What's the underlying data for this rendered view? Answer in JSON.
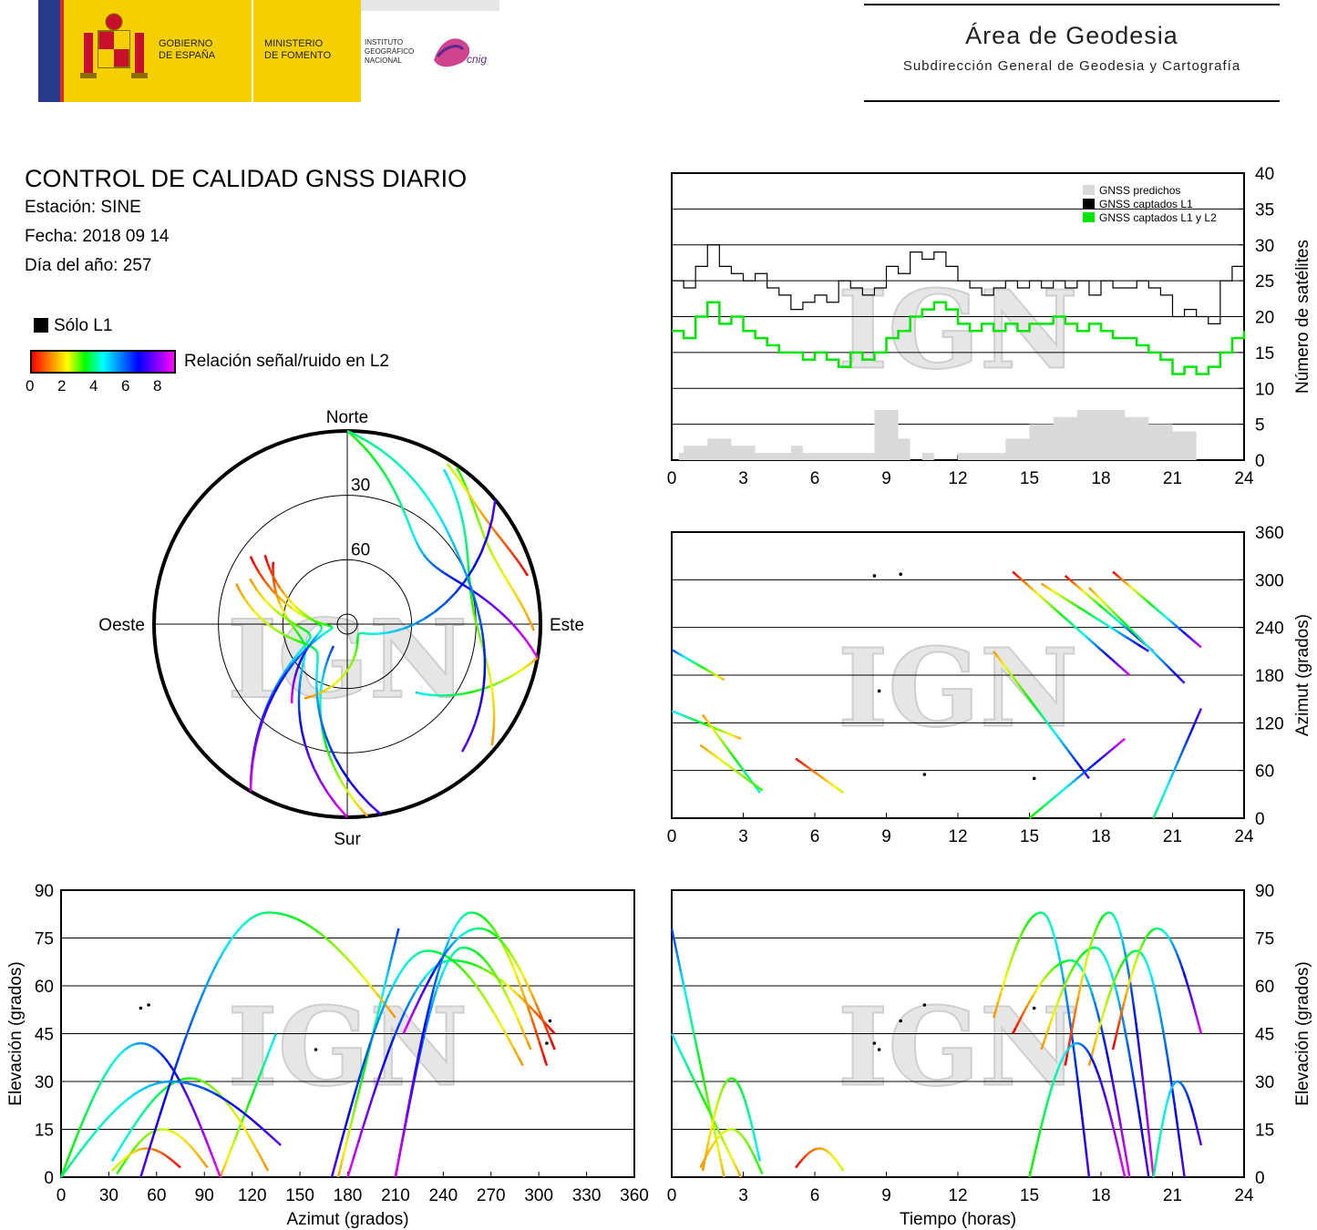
{
  "header": {
    "logo_left": {
      "gobierno": [
        "GOBIERNO",
        "DE ESPAÑA"
      ],
      "ministerio": [
        "MINISTERIO",
        "DE FOMENTO"
      ],
      "instituto": [
        "INSTITUTO",
        "GEOGRÁFICO",
        "NACIONAL"
      ],
      "cnig": "cnig"
    },
    "area_title": "Área de Geodesia",
    "area_subtitle": "Subdirección General de Geodesia y Cartografía"
  },
  "info": {
    "title": "CONTROL DE CALIDAD GNSS DIARIO",
    "station": "Estación: SINE",
    "date": "Fecha: 2018 09 14",
    "doy": "Día del año: 257",
    "only_l1": "Sólo L1",
    "snr_label": "Relación señal/ruido en L2",
    "snr_ticks": [
      "0",
      "2",
      "4",
      "6",
      "8"
    ]
  },
  "watermark": "IGN",
  "colors": {
    "predicted": "#d9d9d9",
    "l1": "#000000",
    "l1l2": "#00e600",
    "grid": "#000000"
  },
  "chart_data": [
    {
      "type": "area",
      "id": "satellite-count",
      "ylabel": "Número de satélites",
      "xlim": [
        0,
        24
      ],
      "ylim": [
        0,
        40
      ],
      "xticks": [
        "0",
        "3",
        "6",
        "9",
        "12",
        "15",
        "18",
        "21",
        "24"
      ],
      "yticks": [
        "0",
        "5",
        "10",
        "15",
        "20",
        "25",
        "30",
        "35",
        "40"
      ],
      "legend": {
        "position": "top-right",
        "entries": [
          "GNSS predichos",
          "GNSS captados L1",
          "GNSS captados L1 y L2"
        ]
      },
      "series": [
        {
          "name": "GNSS predichos",
          "x": [
            0,
            0.3,
            0.5,
            1.5,
            2.5,
            3.5,
            4.5,
            5.0,
            5.5,
            6.0,
            7.0,
            8.0,
            8.5,
            9.0,
            9.5,
            10.0,
            10.5,
            11.0,
            12.0,
            13.0,
            14.0,
            15.0,
            16.0,
            17.0,
            18.0,
            19.0,
            20.0,
            21.0,
            22.0,
            22.2
          ],
          "values": [
            0,
            1,
            2,
            3,
            2,
            1,
            1,
            2,
            1,
            1,
            1,
            1,
            7,
            7,
            3,
            0,
            1,
            0,
            1,
            1,
            3,
            5,
            6,
            7,
            7,
            6,
            5,
            4,
            0,
            0
          ]
        },
        {
          "name": "GNSS captados L1",
          "x": [
            0,
            0.5,
            1,
            1.5,
            2,
            2.5,
            3,
            3.5,
            4,
            4.5,
            5,
            5.5,
            6,
            6.5,
            7,
            7.5,
            8,
            8.5,
            9,
            9.5,
            10,
            10.5,
            11,
            11.5,
            12,
            12.5,
            13,
            13.5,
            14,
            14.5,
            15,
            15.5,
            16,
            16.5,
            17,
            17.5,
            18,
            18.5,
            19,
            19.5,
            20,
            20.5,
            21,
            21.5,
            22,
            22.5,
            23,
            23.5,
            24
          ],
          "values": [
            25,
            24,
            27,
            30,
            27,
            26,
            25,
            26,
            24,
            23,
            21,
            22,
            23,
            22,
            25,
            24,
            23,
            24,
            27,
            26,
            29,
            28,
            29,
            27,
            25,
            24,
            23,
            24,
            25,
            24,
            25,
            24,
            25,
            24,
            25,
            23,
            25,
            24,
            24,
            25,
            24,
            23,
            20,
            21,
            20,
            19,
            25,
            27,
            23
          ]
        },
        {
          "name": "GNSS captados L1 y L2",
          "x": [
            0,
            0.5,
            1,
            1.5,
            2,
            2.5,
            3,
            3.5,
            4,
            4.5,
            5,
            5.5,
            6,
            6.5,
            7,
            7.5,
            8,
            8.5,
            9,
            9.5,
            10,
            10.5,
            11,
            11.5,
            12,
            12.5,
            13,
            13.5,
            14,
            14.5,
            15,
            15.5,
            16,
            16.5,
            17,
            17.5,
            18,
            18.5,
            19,
            19.5,
            20,
            20.5,
            21,
            21.5,
            22,
            22.5,
            23,
            23.5,
            24
          ],
          "values": [
            18,
            17,
            20,
            22,
            19,
            20,
            18,
            17,
            16,
            15,
            15,
            14,
            15,
            14,
            13,
            15,
            14,
            15,
            17,
            18,
            20,
            21,
            22,
            21,
            19,
            18,
            19,
            18,
            19,
            18,
            19,
            19,
            20,
            19,
            18,
            19,
            18,
            17,
            17,
            16,
            15,
            14,
            12,
            13,
            12,
            13,
            15,
            17,
            18
          ]
        }
      ]
    },
    {
      "type": "scatter",
      "id": "azimuth-vs-time",
      "ylabel": "Azimut (grados)",
      "xlim": [
        0,
        24
      ],
      "ylim": [
        0,
        360
      ],
      "xticks": [
        "0",
        "3",
        "6",
        "9",
        "12",
        "15",
        "18",
        "21",
        "24"
      ],
      "yticks": [
        "0",
        "60",
        "120",
        "180",
        "240",
        "300",
        "360"
      ]
    },
    {
      "type": "scatter",
      "id": "elevation-vs-azimuth",
      "xlabel": "Azimut (grados)",
      "ylabel": "Elevación (grados)",
      "xlim": [
        0,
        360
      ],
      "ylim": [
        0,
        90
      ],
      "xticks": [
        "0",
        "30",
        "60",
        "90",
        "120",
        "150",
        "180",
        "210",
        "240",
        "270",
        "300",
        "330",
        "360"
      ],
      "yticks": [
        "0",
        "15",
        "30",
        "45",
        "60",
        "75",
        "90"
      ]
    },
    {
      "type": "scatter",
      "id": "elevation-vs-time",
      "xlabel": "Tiempo (horas)",
      "ylabel": "Elevación (grados)",
      "xlim": [
        0,
        24
      ],
      "ylim": [
        0,
        90
      ],
      "xticks": [
        "0",
        "3",
        "6",
        "9",
        "12",
        "15",
        "18",
        "21",
        "24"
      ],
      "yticks": [
        "0",
        "15",
        "30",
        "45",
        "60",
        "75",
        "90"
      ]
    },
    {
      "type": "scatter",
      "id": "skyplot",
      "labels": {
        "north": "Norte",
        "south": "Sur",
        "east": "Este",
        "west": "Oeste"
      },
      "ring_labels": [
        "30",
        "60"
      ]
    }
  ],
  "tracks": [
    {
      "t0": 0.0,
      "t1": 2.2,
      "az0": 212,
      "az1": 174,
      "el0": 78,
      "el1": 0,
      "s0": 6,
      "s1": 1
    },
    {
      "t0": 0.0,
      "t1": 2.9,
      "az0": 135,
      "az1": 100,
      "el0": 45,
      "el1": 0,
      "s0": 5,
      "s1": 1
    },
    {
      "t0": 1.3,
      "t1": 3.7,
      "az0": 130,
      "az1": 32,
      "el0": 2,
      "el1": 31,
      "el2": 5,
      "s0": 1,
      "s1": 5
    },
    {
      "t0": 1.2,
      "t1": 3.8,
      "az0": 92,
      "az1": 35,
      "el0": 3,
      "el1": 15,
      "el2": 1,
      "s0": 1,
      "s1": 3
    },
    {
      "t0": 5.2,
      "t1": 7.2,
      "az0": 75,
      "az1": 32,
      "el0": 3,
      "el1": 9,
      "el2": 2,
      "s0": 0,
      "s1": 2
    },
    {
      "t0": 13.5,
      "t1": 17.5,
      "az0": 210,
      "az1": 50,
      "el0": 50,
      "el1": 83,
      "el2": 0,
      "s0": 1,
      "s1": 7
    },
    {
      "t0": 14.3,
      "t1": 19.2,
      "az0": 310,
      "az1": 180,
      "el0": 45,
      "el1": 68,
      "el2": 0,
      "s0": 0,
      "s1": 8
    },
    {
      "t0": 15.5,
      "t1": 20.0,
      "az0": 295,
      "az1": 210,
      "el0": 40,
      "el1": 72,
      "el2": 0,
      "s0": 1,
      "s1": 7
    },
    {
      "t0": 16.5,
      "t1": 20.2,
      "az0": 305,
      "az1": 210,
      "el0": 35,
      "el1": 83,
      "el2": 0,
      "s0": 0,
      "s1": 8
    },
    {
      "t0": 17.5,
      "t1": 21.5,
      "az0": 290,
      "az1": 170,
      "el0": 35,
      "el1": 71,
      "el2": 0,
      "s0": 1,
      "s1": 7
    },
    {
      "t0": 18.5,
      "t1": 22.2,
      "az0": 310,
      "az1": 215,
      "el0": 40,
      "el1": 78,
      "el2": 45,
      "s0": 0,
      "s1": 8
    },
    {
      "t0": 15.0,
      "t1": 19.0,
      "az0": 0,
      "az1": 100,
      "el0": 0,
      "el1": 42,
      "el2": 0,
      "s0": 3,
      "s1": 8
    },
    {
      "t0": 20.2,
      "t1": 22.2,
      "az0": 0,
      "az1": 138,
      "el0": 0,
      "el1": 30,
      "el2": 10,
      "s0": 4,
      "s1": 7
    }
  ],
  "l1_only_marks": [
    {
      "t": 8.5,
      "az": 305,
      "el": 42
    },
    {
      "t": 9.6,
      "az": 307,
      "el": 49
    },
    {
      "t": 10.6,
      "az": 55,
      "el": 54
    },
    {
      "t": 15.2,
      "az": 50,
      "el": 53
    },
    {
      "t": 8.7,
      "az": 160,
      "el": 40
    }
  ]
}
